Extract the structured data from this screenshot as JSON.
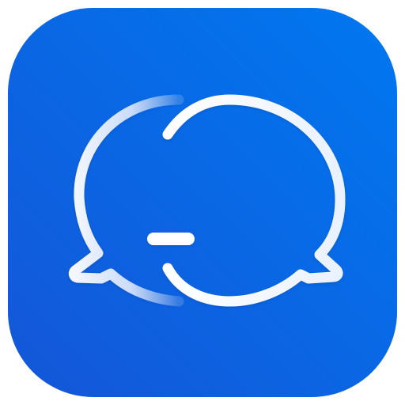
{
  "app_icon": {
    "icon": "chat-bubbles-icon",
    "colors": {
      "background_gradient_start": "#0078F0",
      "background_gradient_end": "#1456D8",
      "glyph_white": "#FFFFFF",
      "glyph_tint": "#D6E4FF"
    }
  }
}
